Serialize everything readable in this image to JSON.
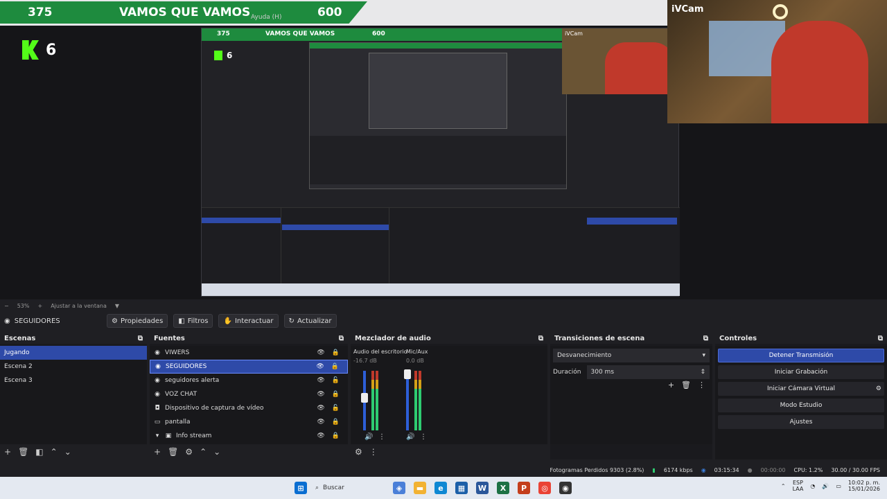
{
  "overlay": {
    "viewers": "375",
    "banner_text": "VAMOS QUE VAMOS",
    "menu_hint": "Ayuda (H)",
    "goal": "600",
    "kick_count": "6",
    "cam_label": "iVCam"
  },
  "zoom": {
    "percent": "53%",
    "fit_label": "Ajustar a la ventana"
  },
  "scene_bar": {
    "current_source": "SEGUIDORES",
    "buttons": [
      "Propiedades",
      "Filtros",
      "Interactuar",
      "Actualizar"
    ]
  },
  "scenes": {
    "title": "Escenas",
    "items": [
      {
        "label": "Jugando",
        "selected": true
      },
      {
        "label": "Escena 2",
        "selected": false
      },
      {
        "label": "Escena 3",
        "selected": false
      }
    ]
  },
  "sources": {
    "title": "Fuentes",
    "items": [
      {
        "label": "VIWERS",
        "icon": "globe-icon",
        "selected": false
      },
      {
        "label": "SEGUIDORES",
        "icon": "globe-icon",
        "selected": true
      },
      {
        "label": "seguidores alerta",
        "icon": "globe-icon",
        "selected": false
      },
      {
        "label": "VOZ CHAT",
        "icon": "globe-icon",
        "selected": false
      },
      {
        "label": "Dispositivo de captura de vídeo",
        "icon": "camera-icon",
        "selected": false
      },
      {
        "label": "pantalla",
        "icon": "monitor-icon",
        "selected": false
      },
      {
        "label": "Info stream",
        "icon": "folder-icon",
        "selected": false
      }
    ]
  },
  "mixer": {
    "title": "Mezclador de audio",
    "channels": [
      {
        "name": "Audio del escritorio",
        "db": "-16.7 dB",
        "level": 0.62
      },
      {
        "name": "Mic/Aux",
        "db": "0.0 dB",
        "level": 1.0
      }
    ]
  },
  "transitions": {
    "title": "Transiciones de escena",
    "selected": "Desvanecimiento",
    "duration_label": "Duración",
    "duration_value": "300 ms"
  },
  "controls": {
    "title": "Controles",
    "buttons": [
      {
        "label": "Detener Transmisión",
        "primary": true
      },
      {
        "label": "Iniciar Grabación",
        "primary": false
      },
      {
        "label": "Iniciar Cámara Virtual",
        "primary": false
      },
      {
        "label": "Modo Estudio",
        "primary": false
      },
      {
        "label": "Ajustes",
        "primary": false
      }
    ]
  },
  "status": {
    "dropped_frames": "Fotogramas Perdidos 9303 (2.8%)",
    "bitrate": "6174 kbps",
    "stream_time": "03:15:34",
    "rec_time": "00:00:00",
    "cpu": "CPU: 1.2%",
    "fps": "30.00 / 30.00 FPS"
  },
  "taskbar": {
    "search_placeholder": "Buscar",
    "lang_top": "ESP",
    "lang_bottom": "LAA",
    "time": "10:02 p. m.",
    "date": "15/01/2026"
  },
  "colors": {
    "accent": "#2e4aa8",
    "banner": "#1e8b3e",
    "kick": "#53fc18"
  }
}
